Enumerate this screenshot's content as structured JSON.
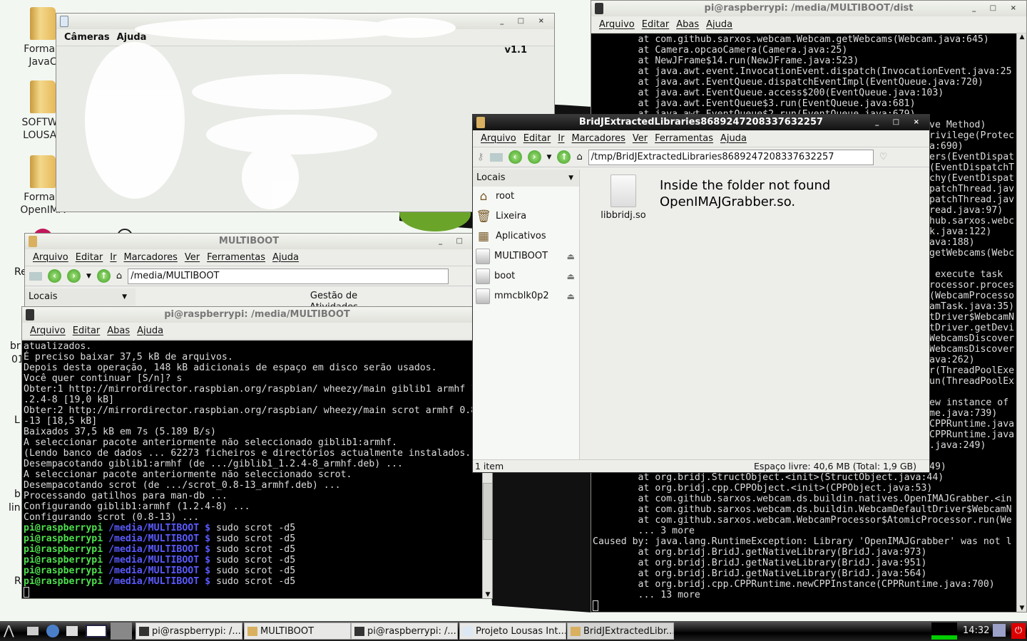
{
  "desktop": {
    "icons": [
      {
        "label": "FormaB\nJavaC"
      },
      {
        "label": "SOFTWA\nLOUSA I"
      },
      {
        "label": "FormaB\nOpenIMA"
      }
    ],
    "side_fragments": [
      "Re",
      "br",
      "01",
      "L",
      "b",
      "lin",
      "R"
    ]
  },
  "java_window": {
    "menu": [
      "Câmeras",
      "Ajuda"
    ],
    "version": "v1.1"
  },
  "right_terminal": {
    "title": "pi@raspberrypi: /media/MULTIBOOT/dist",
    "menu": [
      "Arquivo",
      "Editar",
      "Abas",
      "Ajuda"
    ],
    "lines_top": [
      "        at com.github.sarxos.webcam.Webcam.getWebcams(Webcam.java:645)",
      "        at Camera.opcaoCamera(Camera.java:25)",
      "        at NewJFrame$14.run(NewJFrame.java:523)",
      "        at java.awt.event.InvocationEvent.dispatch(InvocationEvent.java:25",
      "        at java.awt.EventQueue.dispatchEventImpl(EventQueue.java:720)",
      "        at java.awt.EventQueue.access$200(EventQueue.java:103)",
      "        at java.awt.EventQueue$3.run(EventQueue.java:681)",
      "        at java.awt.EventQueue$2.run(EventQueue.java:679)"
    ],
    "fragments": [
      "ve Method)",
      "rivilege(Protec",
      "a:690)",
      "ers(EventDispat",
      "(EventDispatchT",
      "chy(EventDispat",
      "patchThread.jav",
      "patchThread.jav",
      "read.java:97)",
      "hub.sarxos.webc",
      "k.java:122)",
      "ava:188)",
      "getWebcams(Webc",
      "",
      " execute task",
      "rocessor.proces",
      "(WebcamProcesso",
      "amTask.java:35)",
      "tDriver$WebcamN",
      "tDriver.getDevi",
      "WebcamsDiscover",
      "WebcamsDiscover",
      "ava:262)",
      "r(ThreadPoolExe",
      "un(ThreadPoolEx",
      "",
      "ew instance of",
      "me.java:739)",
      "CPPRuntime.java",
      "CPPRuntime.java",
      ".java:249)",
      "",
      "49)"
    ],
    "lines_bottom": [
      "        at org.bridj.StructObject.<init>(StructObject.java:44)",
      "        at org.bridj.cpp.CPPObject.<init>(CPPObject.java:53)",
      "        at com.github.sarxos.webcam.ds.buildin.natives.OpenIMAJGrabber.<in",
      "        at com.github.sarxos.webcam.ds.buildin.WebcamDefaultDriver$WebcamN",
      "        at com.github.sarxos.webcam.WebcamProcessor$AtomicProcessor.run(We",
      "        ... 3 more",
      "Caused by: java.lang.RuntimeException: Library 'OpenIMAJGrabber' was not l",
      "        at org.bridj.BridJ.getNativeLibrary(BridJ.java:973)",
      "        at org.bridj.BridJ.getNativeLibrary(BridJ.java:951)",
      "        at org.bridj.BridJ.getNativeLibrary(BridJ.java:564)",
      "        at org.bridj.cpp.CPPRuntime.newCPPInstance(CPPRuntime.java:700)",
      "        ... 13 more"
    ]
  },
  "bridj_fm": {
    "title": "BridJExtractedLibraries8689247208337632257",
    "menu": [
      "Arquivo",
      "Editar",
      "Ir",
      "Marcadores",
      "Ver",
      "Ferramentas",
      "Ajuda"
    ],
    "address": "/tmp/BridJExtractedLibraries8689247208337632257",
    "places_label": "Locais",
    "places": [
      {
        "label": "root",
        "icon": "home-icon"
      },
      {
        "label": "Lixeira",
        "icon": "trash-icon"
      },
      {
        "label": "Aplicativos",
        "icon": "applications-icon"
      },
      {
        "label": "MULTIBOOT",
        "icon": "drive-icon",
        "eject": true
      },
      {
        "label": "boot",
        "icon": "drive-icon",
        "eject": true
      },
      {
        "label": "mmcblk0p2",
        "icon": "drive-icon",
        "eject": true
      }
    ],
    "file": "libbridj.so",
    "annotation": "Inside the folder not found\nOpenIMAJGrabber.so.",
    "status_items": "1 item",
    "status_space": "Espaço livre: 40,6 MB (Total: 1,9 GB)"
  },
  "multiboot_fm": {
    "title": "MULTIBOOT",
    "menu": [
      "Arquivo",
      "Editar",
      "Ir",
      "Marcadores",
      "Ver",
      "Ferramentas",
      "Ajuda"
    ],
    "address": "/media/MULTIBOOT",
    "places_label": "Locais",
    "item_partial": "Gestão de\nAtividades"
  },
  "left_terminal": {
    "title": "pi@raspberrypi: /media/MULTIBOOT",
    "menu": [
      "Arquivo",
      "Editar",
      "Abas",
      "Ajuda"
    ],
    "lines": [
      "atualizados.",
      "É preciso baixar 37,5 kB de arquivos.",
      "Depois desta operação, 148 kB adicionais de espaço em disco serão usados.",
      "Você quer continuar [S/n]? s",
      "Obter:1 http://mirrordirector.raspbian.org/raspbian/ wheezy/main giblib1 armhf 1",
      ".2.4-8 [19,0 kB]",
      "Obter:2 http://mirrordirector.raspbian.org/raspbian/ wheezy/main scrot armhf 0.8",
      "-13 [18,5 kB]",
      "Baixados 37,5 kB em 7s (5.189 B/s)",
      "A seleccionar pacote anteriormente não seleccionado giblib1:armhf.",
      "(Lendo banco de dados ... 62273 ficheiros e directórios actualmente instalados.)",
      "Desempacotando giblib1:armhf (de .../giblib1_1.2.4-8_armhf.deb) ...",
      "A seleccionar pacote anteriormente não seleccionado scrot.",
      "Desempacotando scrot (de .../scrot_0.8-13_armhf.deb) ...",
      "Processando gatilhos para man-db ...",
      "Configurando giblib1:armhf (1.2.4-8) ...",
      "Configurando scrot (0.8-13) ..."
    ],
    "prompt_user": "pi@raspberrypi",
    "prompt_path": "/media/MULTIBOOT",
    "prompt_sign": "$",
    "command": "sudo scrot -d5",
    "prompt_count": 6
  },
  "taskbar": {
    "tasks": [
      "pi@raspberrypi: /...",
      "MULTIBOOT",
      "pi@raspberrypi: /...",
      "Projeto Lousas Int...",
      "BridJExtractedLibr..."
    ],
    "clock": "14:32"
  }
}
